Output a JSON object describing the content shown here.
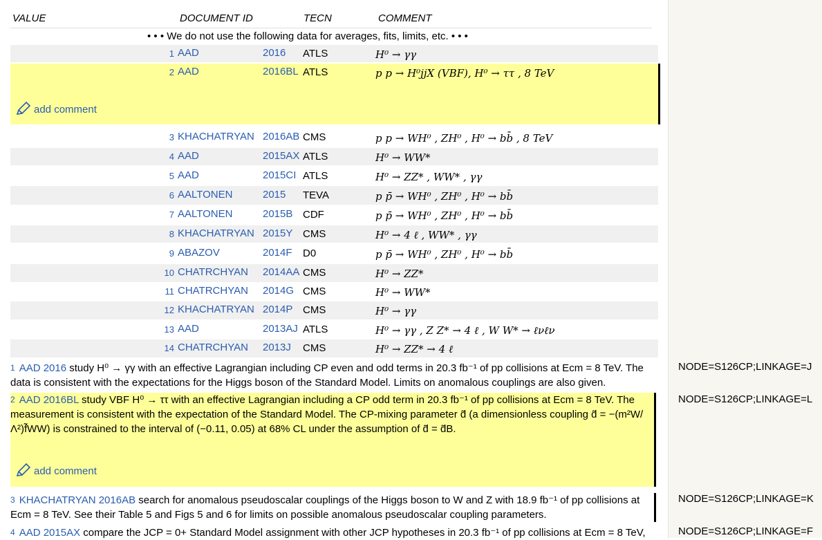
{
  "headers": {
    "value": "VALUE",
    "docid": "DOCUMENT ID",
    "tecn": "TECN",
    "comment": "COMMENT"
  },
  "note": "• • • We do not use the following data for averages, fits, limits, etc. • • •",
  "add_comment": "add comment",
  "rows": [
    {
      "n": "1",
      "author": "AAD",
      "year": "2016",
      "tecn": "ATLS",
      "comment": "H⁰ → γγ"
    },
    {
      "n": "2",
      "author": "AAD",
      "year": "2016BL",
      "tecn": "ATLS",
      "comment": "p p → H⁰jjX (VBF), H⁰ → ττ , 8 TeV"
    },
    {
      "n": "3",
      "author": "KHACHATRYAN",
      "year": "2016AB",
      "tecn": "CMS",
      "comment": "p p → WH⁰ , ZH⁰ , H⁰ → bb̄ , 8 TeV"
    },
    {
      "n": "4",
      "author": "AAD",
      "year": "2015AX",
      "tecn": "ATLS",
      "comment": "H⁰ → WW*"
    },
    {
      "n": "5",
      "author": "AAD",
      "year": "2015CI",
      "tecn": "ATLS",
      "comment": "H⁰ → ZZ* , WW* , γγ"
    },
    {
      "n": "6",
      "author": "AALTONEN",
      "year": "2015",
      "tecn": "TEVA",
      "comment": "p p̄ → WH⁰ , ZH⁰ , H⁰ → bb̄"
    },
    {
      "n": "7",
      "author": "AALTONEN",
      "year": "2015B",
      "tecn": "CDF",
      "comment": "p p̄ → WH⁰ , ZH⁰ , H⁰ → bb̄"
    },
    {
      "n": "8",
      "author": "KHACHATRYAN",
      "year": "2015Y",
      "tecn": "CMS",
      "comment": "H⁰ → 4 ℓ , WW* , γγ"
    },
    {
      "n": "9",
      "author": "ABAZOV",
      "year": "2014F",
      "tecn": "D0",
      "comment": "p p̄ → WH⁰ , ZH⁰ , H⁰ → bb̄"
    },
    {
      "n": "10",
      "author": "CHATRCHYAN",
      "year": "2014AA",
      "tecn": "CMS",
      "comment": "H⁰ → ZZ*"
    },
    {
      "n": "11",
      "author": "CHATRCHYAN",
      "year": "2014G",
      "tecn": "CMS",
      "comment": "H⁰ → WW*"
    },
    {
      "n": "12",
      "author": "KHACHATRYAN",
      "year": "2014P",
      "tecn": "CMS",
      "comment": "H⁰ → γγ"
    },
    {
      "n": "13",
      "author": "AAD",
      "year": "2013AJ",
      "tecn": "ATLS",
      "comment": "H⁰ → γγ , Z Z* → 4 ℓ , W W* → ℓνℓν"
    },
    {
      "n": "14",
      "author": "CHATRCHYAN",
      "year": "2013J",
      "tecn": "CMS",
      "comment": "H⁰ → ZZ* → 4 ℓ"
    }
  ],
  "footnotes": {
    "f1": {
      "n": "1",
      "ref": "AAD 2016",
      "text": " study H⁰ → γγ with an effective Lagrangian including CP even and odd terms in 20.3 fb⁻¹ of pp collisions at Ecm = 8 TeV. The data is consistent with the expectations for the Higgs boson of the Standard Model. Limits on anomalous couplings are also given.",
      "node": "NODE=S126CP;LINKAGE=J"
    },
    "f2": {
      "n": "2",
      "ref": "AAD 2016BL",
      "text": " study VBF H⁰ → ττ with an effective Lagrangian including a CP odd term in 20.3 fb⁻¹ of pp collisions at Ecm = 8 TeV. The measurement is consistent with the expectation of the Standard Model. The CP-mixing parameter d̃ (a dimensionless coupling d̃ = −(m²W/Λ²)f̃WW) is constrained to the interval of (−0.11, 0.05) at 68% CL under the assumption of d̃ = d̃B.",
      "node": "NODE=S126CP;LINKAGE=L"
    },
    "f3": {
      "n": "3",
      "ref": "KHACHATRYAN 2016AB",
      "text": " search for anomalous pseudoscalar couplings of the Higgs boson to W and Z with 18.9 fb⁻¹ of pp collisions at Ecm = 8 TeV. See their Table 5 and Figs 5 and 6 for limits on possible anomalous pseudoscalar coupling parameters.",
      "node": "NODE=S126CP;LINKAGE=K"
    },
    "f4": {
      "n": "4",
      "ref": "AAD 2015AX",
      "text": " compare the JCP = 0+ Standard Model assignment with other JCP hypotheses in 20.3 fb⁻¹ of pp collisions at Ecm = 8 TeV,",
      "node": "NODE=S126CP;LINKAGE=F"
    }
  }
}
